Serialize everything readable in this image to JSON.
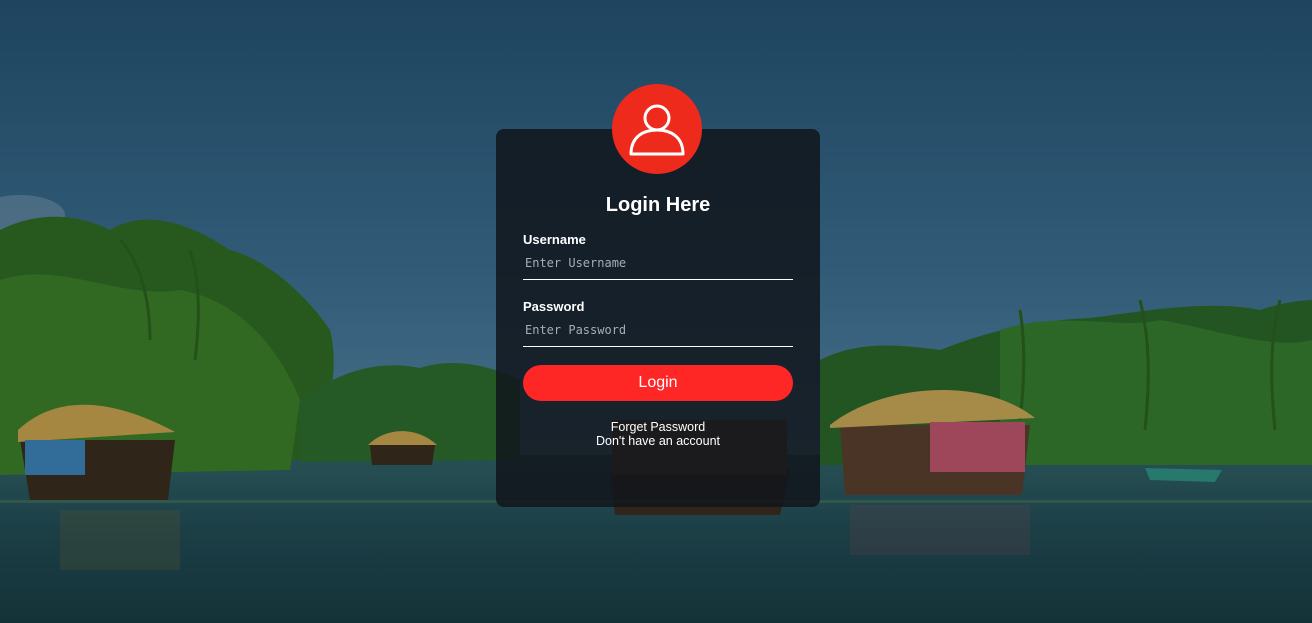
{
  "avatar_icon": "user-icon",
  "login": {
    "title": "Login Here",
    "username_label": "Username",
    "username_placeholder": "Enter Username",
    "password_label": "Password",
    "password_placeholder": "Enter Password",
    "login_button": "Login",
    "forget_password_link": "Forget Password",
    "no_account_link": "Don't have an account"
  },
  "colors": {
    "accent": "#ff2626",
    "avatar_bg": "#ee2a1c",
    "card_bg": "rgba(16,20,26,0.84)"
  }
}
